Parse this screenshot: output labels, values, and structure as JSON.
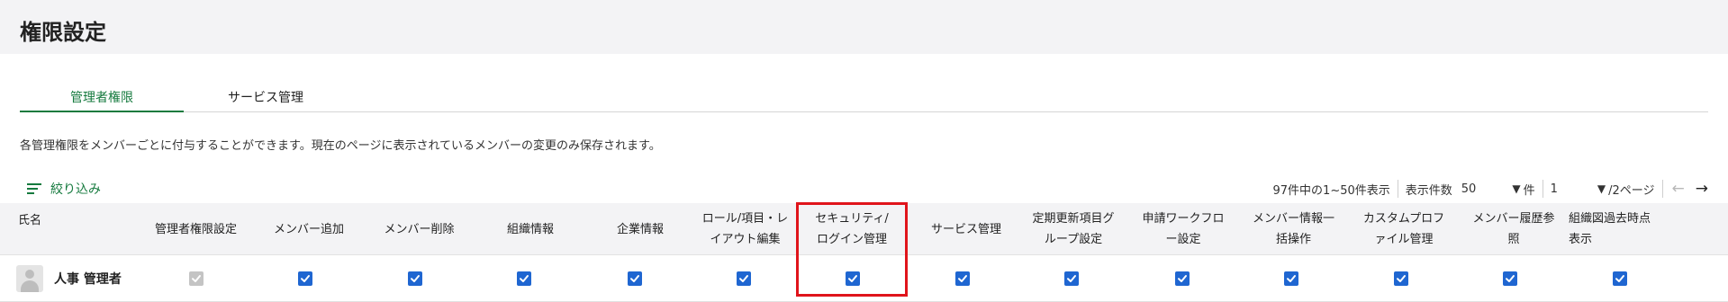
{
  "page": {
    "title": "権限設定"
  },
  "tabs": [
    {
      "label": "管理者権限",
      "active": true
    },
    {
      "label": "サービス管理",
      "active": false
    }
  ],
  "description": "各管理権限をメンバーごとに付与することができます。現在のページに表示されているメンバーの変更のみ保存されます。",
  "filter": {
    "label": "絞り込み",
    "icon": "filter-lines-icon"
  },
  "pagination": {
    "range_text": "97件中の1~50件表示",
    "per_page_label": "表示件数",
    "per_page_value": "50",
    "per_page_unit": "件",
    "current_page": "1",
    "total_pages_text": "/2ページ",
    "prev_icon": "arrow-left-icon",
    "next_icon": "arrow-right-icon"
  },
  "table": {
    "name_header": "氏名",
    "columns": [
      {
        "line1": "管理者権限設定",
        "line2": ""
      },
      {
        "line1": "メンバー追加",
        "line2": ""
      },
      {
        "line1": "メンバー削除",
        "line2": ""
      },
      {
        "line1": "組織情報",
        "line2": ""
      },
      {
        "line1": "企業情報",
        "line2": ""
      },
      {
        "line1": "ロール/項目・レ",
        "line2": "イアウト編集"
      },
      {
        "line1": "セキュリティ/",
        "line2": "ログイン管理"
      },
      {
        "line1": "サービス管理",
        "line2": ""
      },
      {
        "line1": "定期更新項目グ",
        "line2": "ループ設定"
      },
      {
        "line1": "申請ワークフロ",
        "line2": "ー設定"
      },
      {
        "line1": "メンバー情報一",
        "line2": "括操作"
      },
      {
        "line1": "カスタムプロフ",
        "line2": "ァイル管理"
      },
      {
        "line1": "メンバー履歴参",
        "line2": "照"
      },
      {
        "line1": "組織図過去時点",
        "line2": "表示"
      }
    ],
    "rows": [
      {
        "name": "人事 管理者",
        "avatar_icon": "user-avatar-icon",
        "permissions": [
          {
            "checked": true,
            "disabled": true
          },
          {
            "checked": true,
            "disabled": false
          },
          {
            "checked": true,
            "disabled": false
          },
          {
            "checked": true,
            "disabled": false
          },
          {
            "checked": true,
            "disabled": false
          },
          {
            "checked": true,
            "disabled": false
          },
          {
            "checked": true,
            "disabled": false
          },
          {
            "checked": true,
            "disabled": false
          },
          {
            "checked": true,
            "disabled": false
          },
          {
            "checked": true,
            "disabled": false
          },
          {
            "checked": true,
            "disabled": false
          },
          {
            "checked": true,
            "disabled": false
          },
          {
            "checked": true,
            "disabled": false
          },
          {
            "checked": true,
            "disabled": false
          }
        ]
      }
    ]
  },
  "colors": {
    "accent_green": "#157a3e",
    "checkbox_blue": "#1f66d1",
    "checkbox_disabled": "#c4c4c4",
    "highlight_red": "#e0141b",
    "header_bg": "#f3f3f5"
  }
}
